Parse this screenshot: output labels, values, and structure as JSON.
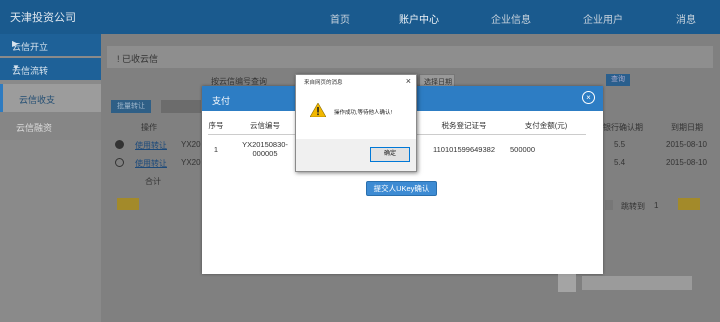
{
  "app": {
    "company": "天津投资公司"
  },
  "topnav": {
    "items": [
      {
        "label": "首页"
      },
      {
        "label": "账户中心"
      },
      {
        "label": "企业信息"
      },
      {
        "label": "企业用户"
      },
      {
        "label": "消息"
      }
    ],
    "active": "账户中心"
  },
  "sidebar": {
    "groups": [
      {
        "label": "云信开立",
        "arrow": "▶"
      },
      {
        "label": "云信流转",
        "arrow": "▼"
      }
    ],
    "items": [
      {
        "label": "云信收支"
      },
      {
        "label": "云信融资"
      }
    ]
  },
  "page": {
    "breadcrumb": "! 已收云信",
    "filter_label": "按云信编号查询",
    "date_placeholder": "选择日期",
    "search_label": "查询",
    "toolbar": {
      "button1": "批量转让"
    },
    "columns": [
      "操作",
      "银行确认期",
      "到期日期"
    ],
    "rows": [
      {
        "action": "使用转让",
        "id": "YX20",
        "period": "5.5",
        "date": "2015-08-10"
      },
      {
        "action": "使用转让",
        "id": "YX20",
        "period": "5.4",
        "date": "2015-08-10"
      }
    ],
    "total_label": "合计",
    "pager": {
      "goto_label": "跳转到",
      "page": "1"
    }
  },
  "pay_modal": {
    "title": "支付",
    "columns": [
      "序号",
      "云信编号",
      "税务登记证号",
      "支付金额(元)"
    ],
    "rows": [
      {
        "no": "1",
        "id_line1": "YX20150830-",
        "id_line2": "000005",
        "tax_no": "110101599649382",
        "amount": "500000"
      }
    ],
    "confirm_button": "提交人UKey确认"
  },
  "alert_dialog": {
    "title": "来自网页的消息",
    "message": "操作成功,等待他人确认!",
    "ok_label": "确定",
    "close_glyph": "×",
    "icon": "warning-icon"
  },
  "colors": {
    "nav_bg": "#1a5a8e",
    "accent": "#2d7dc4",
    "warning": "#f2b800"
  }
}
